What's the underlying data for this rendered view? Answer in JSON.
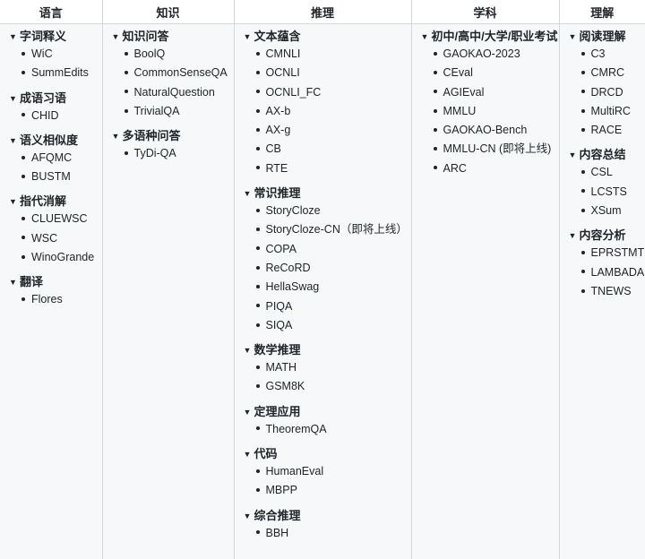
{
  "columns": [
    {
      "header": "语言",
      "groups": [
        {
          "title": "字词释义",
          "items": [
            "WiC",
            "SummEdits"
          ]
        },
        {
          "title": "成语习语",
          "items": [
            "CHID"
          ]
        },
        {
          "title": "语义相似度",
          "items": [
            "AFQMC",
            "BUSTM"
          ]
        },
        {
          "title": "指代消解",
          "items": [
            "CLUEWSC",
            "WSC",
            "WinoGrande"
          ]
        },
        {
          "title": "翻译",
          "items": [
            "Flores"
          ]
        }
      ]
    },
    {
      "header": "知识",
      "groups": [
        {
          "title": "知识问答",
          "items": [
            "BoolQ",
            "CommonSenseQA",
            "NaturalQuestion",
            "TrivialQA"
          ]
        },
        {
          "title": "多语种问答",
          "items": [
            "TyDi-QA"
          ]
        }
      ]
    },
    {
      "header": "推理",
      "groups": [
        {
          "title": "文本蕴含",
          "items": [
            "CMNLI",
            "OCNLI",
            "OCNLI_FC",
            "AX-b",
            "AX-g",
            "CB",
            "RTE"
          ]
        },
        {
          "title": "常识推理",
          "items": [
            "StoryCloze",
            "StoryCloze-CN（即将上线）",
            "COPA",
            "ReCoRD",
            "HellaSwag",
            "PIQA",
            "SIQA"
          ]
        },
        {
          "title": "数学推理",
          "items": [
            "MATH",
            "GSM8K"
          ]
        },
        {
          "title": "定理应用",
          "items": [
            "TheoremQA"
          ]
        },
        {
          "title": "代码",
          "items": [
            "HumanEval",
            "MBPP"
          ]
        },
        {
          "title": "综合推理",
          "items": [
            "BBH"
          ]
        }
      ]
    },
    {
      "header": "学科",
      "groups": [
        {
          "title": "初中/高中/大学/职业考试",
          "items": [
            "GAOKAO-2023",
            "CEval",
            "AGIEval",
            "MMLU",
            "GAOKAO-Bench",
            "MMLU-CN (即将上线)",
            "ARC"
          ]
        }
      ]
    },
    {
      "header": "理解",
      "groups": [
        {
          "title": "阅读理解",
          "items": [
            "C3",
            "CMRC",
            "DRCD",
            "MultiRC",
            "RACE"
          ]
        },
        {
          "title": "内容总结",
          "items": [
            "CSL",
            "LCSTS",
            "XSum"
          ]
        },
        {
          "title": "内容分析",
          "items": [
            "EPRSTMT",
            "LAMBADA",
            "TNEWS"
          ]
        }
      ]
    }
  ]
}
